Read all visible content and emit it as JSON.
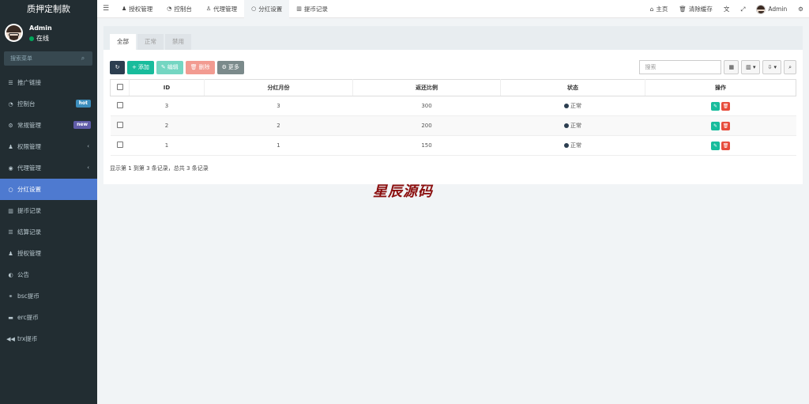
{
  "sidebar": {
    "brand": "质押定制款",
    "user": {
      "name": "Admin",
      "status": "在线"
    },
    "search_placeholder": "搜索菜单",
    "items": [
      {
        "label": "推广链接",
        "icon": "list-icon"
      },
      {
        "label": "控制台",
        "icon": "dashboard-icon",
        "badge": "hot"
      },
      {
        "label": "常规管理",
        "icon": "gears-icon",
        "badge": "new"
      },
      {
        "label": "权限管理",
        "icon": "group-icon",
        "arrow": "‹"
      },
      {
        "label": "代理管理",
        "icon": "user-circle-icon",
        "arrow": "‹"
      },
      {
        "label": "分红设置",
        "icon": "circle-icon",
        "active": true
      },
      {
        "label": "提币记录",
        "icon": "bar-chart-icon"
      },
      {
        "label": "结算记录",
        "icon": "list-icon"
      },
      {
        "label": "授权管理",
        "icon": "group-icon"
      },
      {
        "label": "公告",
        "icon": "adjust-icon"
      },
      {
        "label": "bsc提币",
        "icon": "bicycle-icon"
      },
      {
        "label": "erc提币",
        "icon": "briefcase-icon"
      },
      {
        "label": "trx提币",
        "icon": "backward-icon"
      }
    ]
  },
  "topnav": {
    "tabs": [
      {
        "label": "授权管理",
        "icon": "group-icon"
      },
      {
        "label": "控制台",
        "icon": "dashboard-icon"
      },
      {
        "label": "代理管理",
        "icon": "user-icon"
      },
      {
        "label": "分红设置",
        "icon": "circle-icon",
        "active": true
      },
      {
        "label": "提币记录",
        "icon": "bar-chart-icon"
      }
    ],
    "right": {
      "home": "主页",
      "clear_cache": "清除缓存",
      "user": "Admin"
    }
  },
  "panel": {
    "tabs": [
      "全部",
      "正常",
      "禁用"
    ],
    "toolbar": {
      "add": "添加",
      "edit": "编辑",
      "delete": "删除",
      "more": "更多"
    },
    "search_placeholder": "搜索",
    "table": {
      "headers": [
        "ID",
        "分红月份",
        "返还比例",
        "状态",
        "操作"
      ],
      "rows": [
        {
          "id": "3",
          "month": "3",
          "ratio": "300",
          "status": "正常"
        },
        {
          "id": "2",
          "month": "2",
          "ratio": "200",
          "status": "正常"
        },
        {
          "id": "1",
          "month": "1",
          "ratio": "150",
          "status": "正常"
        }
      ]
    },
    "pager_text": "显示第 1 到第 3 条记录，总共 3 条记录"
  },
  "watermark": "星辰源码"
}
